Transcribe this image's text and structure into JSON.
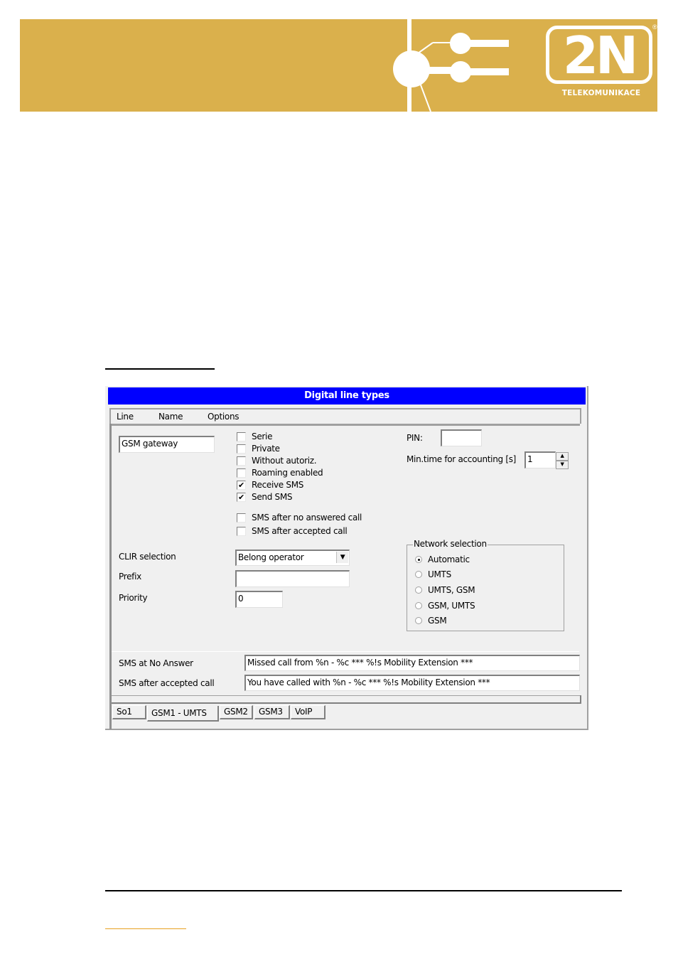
{
  "header": {
    "logo_text": "2N",
    "logo_subtitle": "TELEKOMUNIKACE",
    "logo_registered": "®",
    "brand_color": "#dab04c"
  },
  "dialog": {
    "title": "Digital line types",
    "title_bar_color": "#0000ff",
    "menu": [
      "Line",
      "Name",
      "Options"
    ],
    "name_field": {
      "value": "GSM gateway"
    },
    "checkboxes": [
      {
        "label": "Serie",
        "checked": false
      },
      {
        "label": "Private",
        "checked": false
      },
      {
        "label": "Without autoriz.",
        "checked": false
      },
      {
        "label": "Roaming enabled",
        "checked": false
      },
      {
        "label": "Receive SMS",
        "checked": true
      },
      {
        "label": "Send SMS",
        "checked": true
      },
      {
        "label": "SMS after no answered call",
        "checked": false
      },
      {
        "label": "SMS after accepted call",
        "checked": false
      }
    ],
    "pin": {
      "label": "PIN:",
      "value": ""
    },
    "min_time": {
      "label": "Min.time for accounting [s]",
      "value": "1"
    },
    "clir": {
      "label": "CLIR selection",
      "value": "Belong operator"
    },
    "prefix": {
      "label": "Prefix",
      "value": ""
    },
    "priority": {
      "label": "Priority",
      "value": "0"
    },
    "network_selection": {
      "title": "Network selection",
      "options": [
        {
          "label": "Automatic",
          "selected": true
        },
        {
          "label": "UMTS",
          "selected": false
        },
        {
          "label": "UMTS, GSM",
          "selected": false
        },
        {
          "label": "GSM, UMTS",
          "selected": false
        },
        {
          "label": "GSM",
          "selected": false
        }
      ]
    },
    "sms_no_answer": {
      "label": "SMS at No Answer",
      "value": "Missed call from %n - %c *** %!s Mobility Extension ***"
    },
    "sms_accepted": {
      "label": "SMS after accepted call",
      "value": "You have called with %n - %c *** %!s Mobility Extension ***"
    },
    "tabs": [
      {
        "label": "So1",
        "active": false
      },
      {
        "label": "GSM1 - UMTS",
        "active": true
      },
      {
        "label": "GSM2",
        "active": false
      },
      {
        "label": "GSM3",
        "active": false
      },
      {
        "label": "VoIP",
        "active": false
      }
    ]
  }
}
